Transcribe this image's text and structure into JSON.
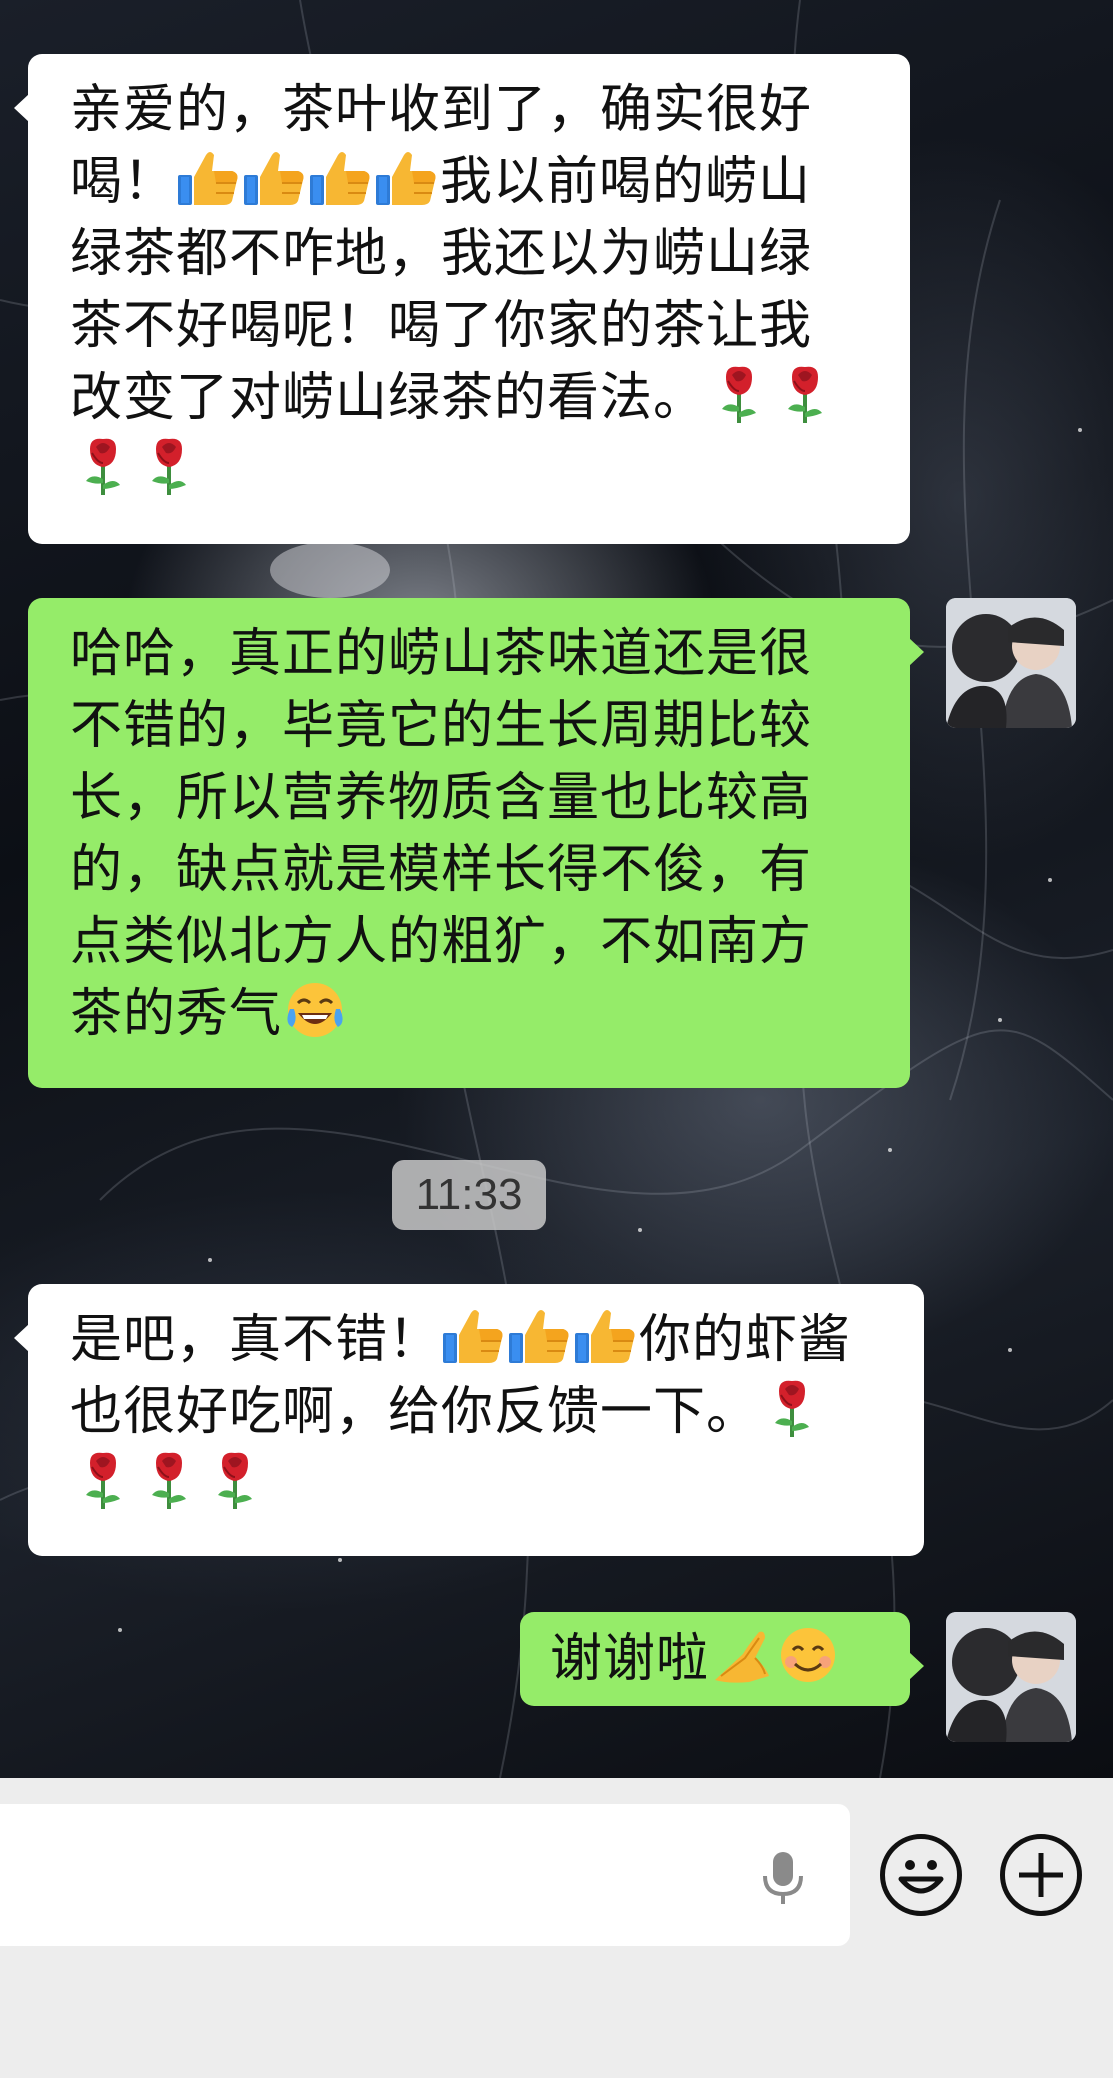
{
  "messages": [
    {
      "id": "m1",
      "side": "received",
      "lines": [
        "亲爱的，茶叶收到了，确实很好",
        "喝！",
        "我以前喝的崂山",
        "绿茶都不咋地，我还以为崂山绿",
        "茶不好喝呢！喝了你家的茶让我",
        "改变了对崂山绿茶的看法。"
      ],
      "emoji": [
        "thumbs-up",
        "thumbs-up",
        "thumbs-up",
        "thumbs-up",
        "rose",
        "rose",
        "rose",
        "rose"
      ]
    },
    {
      "id": "m2",
      "side": "sent",
      "lines": [
        "哈哈，真正的崂山茶味道还是很",
        "不错的，毕竟它的生长周期比较",
        "长，所以营养物质含量也比较高",
        "的，缺点就是模样长得不俊，有",
        "点类似北方人的粗犷，不如南方",
        "茶的秀气"
      ],
      "emoji": [
        "laugh-cry"
      ]
    },
    {
      "id": "m3",
      "side": "received",
      "lines": [
        "是吧，真不错！",
        "你的虾酱",
        "也很好吃啊，给你反馈一下。"
      ],
      "emoji": [
        "thumbs-up",
        "thumbs-up",
        "thumbs-up",
        "rose",
        "rose",
        "rose",
        "rose"
      ]
    },
    {
      "id": "m4",
      "side": "sent",
      "lines": [
        "谢谢啦"
      ],
      "emoji": [
        "praying-hands",
        "smiling-face"
      ]
    }
  ],
  "timestamp": "11:33",
  "input_bar": {
    "voice_icon": "microphone-icon",
    "emoji_icon": "smiley-icon",
    "plus_icon": "plus-icon"
  },
  "colors": {
    "sent_bubble": "#95ec69",
    "received_bubble": "#ffffff",
    "input_bar": "#ededed"
  }
}
